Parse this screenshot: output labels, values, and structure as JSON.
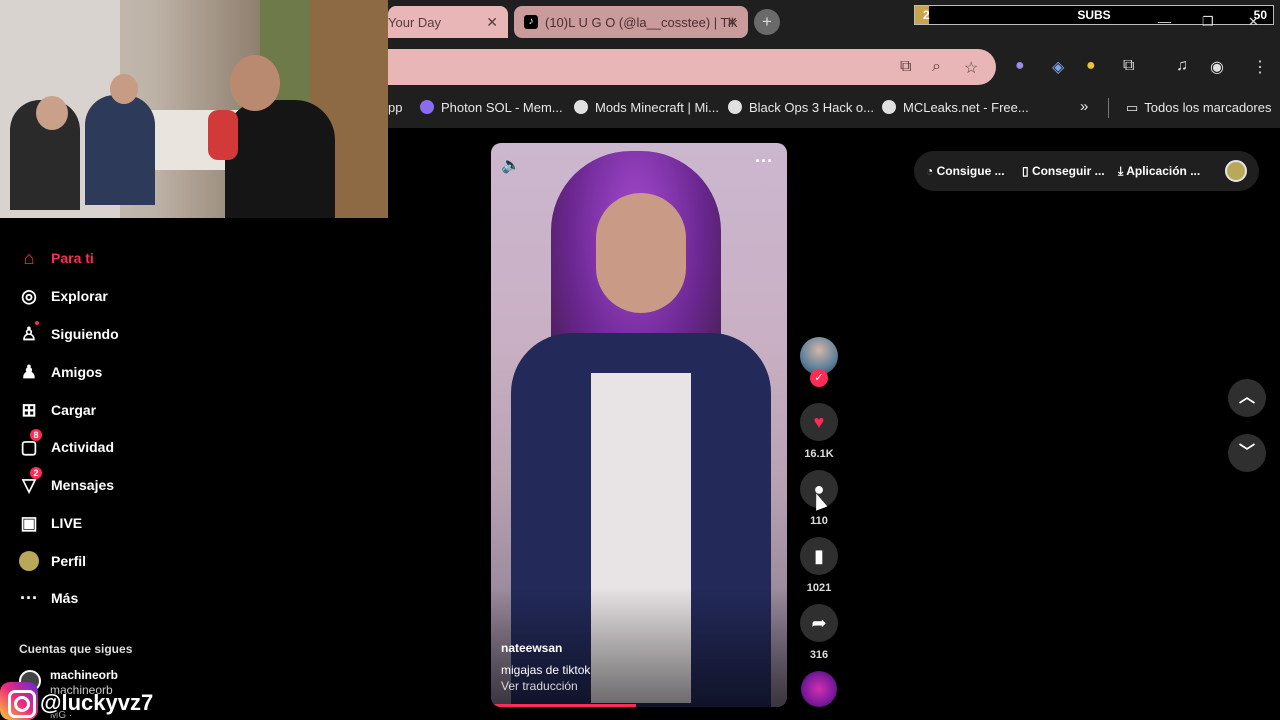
{
  "browser": {
    "tabs": [
      {
        "title": "Your Day",
        "close": "✕"
      },
      {
        "title": "(10)L U G O (@la__cosstee) | Tik",
        "close": "✕"
      }
    ],
    "new_tab": "+",
    "omnibox_icons": [
      "install-icon",
      "zoom-icon",
      "star-icon"
    ],
    "bookmarks": [
      {
        "label": "pp"
      },
      {
        "label": "Photon SOL - Mem..."
      },
      {
        "label": "Mods Minecraft | Mi..."
      },
      {
        "label": "Black Ops 3 Hack o..."
      },
      {
        "label": "MCLeaks.net - Free..."
      }
    ],
    "bookmarks_overflow": "»",
    "all_bookmarks": "Todos los marcadores"
  },
  "subs_overlay": {
    "label": "SUBS",
    "current": "2",
    "goal": "50",
    "progress": 0.04
  },
  "sidebar": {
    "items": [
      {
        "label": "Para ti",
        "icon": "home-icon",
        "active": true
      },
      {
        "label": "Explorar",
        "icon": "compass-icon"
      },
      {
        "label": "Siguiendo",
        "icon": "following-icon"
      },
      {
        "label": "Amigos",
        "icon": "friends-icon"
      },
      {
        "label": "Cargar",
        "icon": "upload-icon"
      },
      {
        "label": "Actividad",
        "icon": "activity-icon",
        "badge": "8"
      },
      {
        "label": "Mensajes",
        "icon": "messages-icon",
        "badge": "2"
      },
      {
        "label": "LIVE",
        "icon": "live-icon"
      },
      {
        "label": "Perfil",
        "icon": "profile-icon"
      },
      {
        "label": "Más",
        "icon": "more-icon"
      }
    ],
    "following_heading": "Cuentas que sigues",
    "account_name": "machineorb",
    "account_handle": "machineorb",
    "account_extra": "MG ·"
  },
  "watermark": {
    "handle": "@luckyvz7"
  },
  "video": {
    "author": "nateewsan",
    "caption": "migajas de tiktok",
    "translate": "Ver traducción",
    "progress": 0.49
  },
  "actions": {
    "likes": "16.1K",
    "comments": "110",
    "saves": "1021",
    "shares": "316"
  },
  "top_pill": {
    "items": [
      "Consigue ...",
      "Conseguir ...",
      "Aplicación ..."
    ]
  },
  "colors": {
    "accent": "#fe2c55",
    "tab_tint": "#e8b6b6"
  }
}
